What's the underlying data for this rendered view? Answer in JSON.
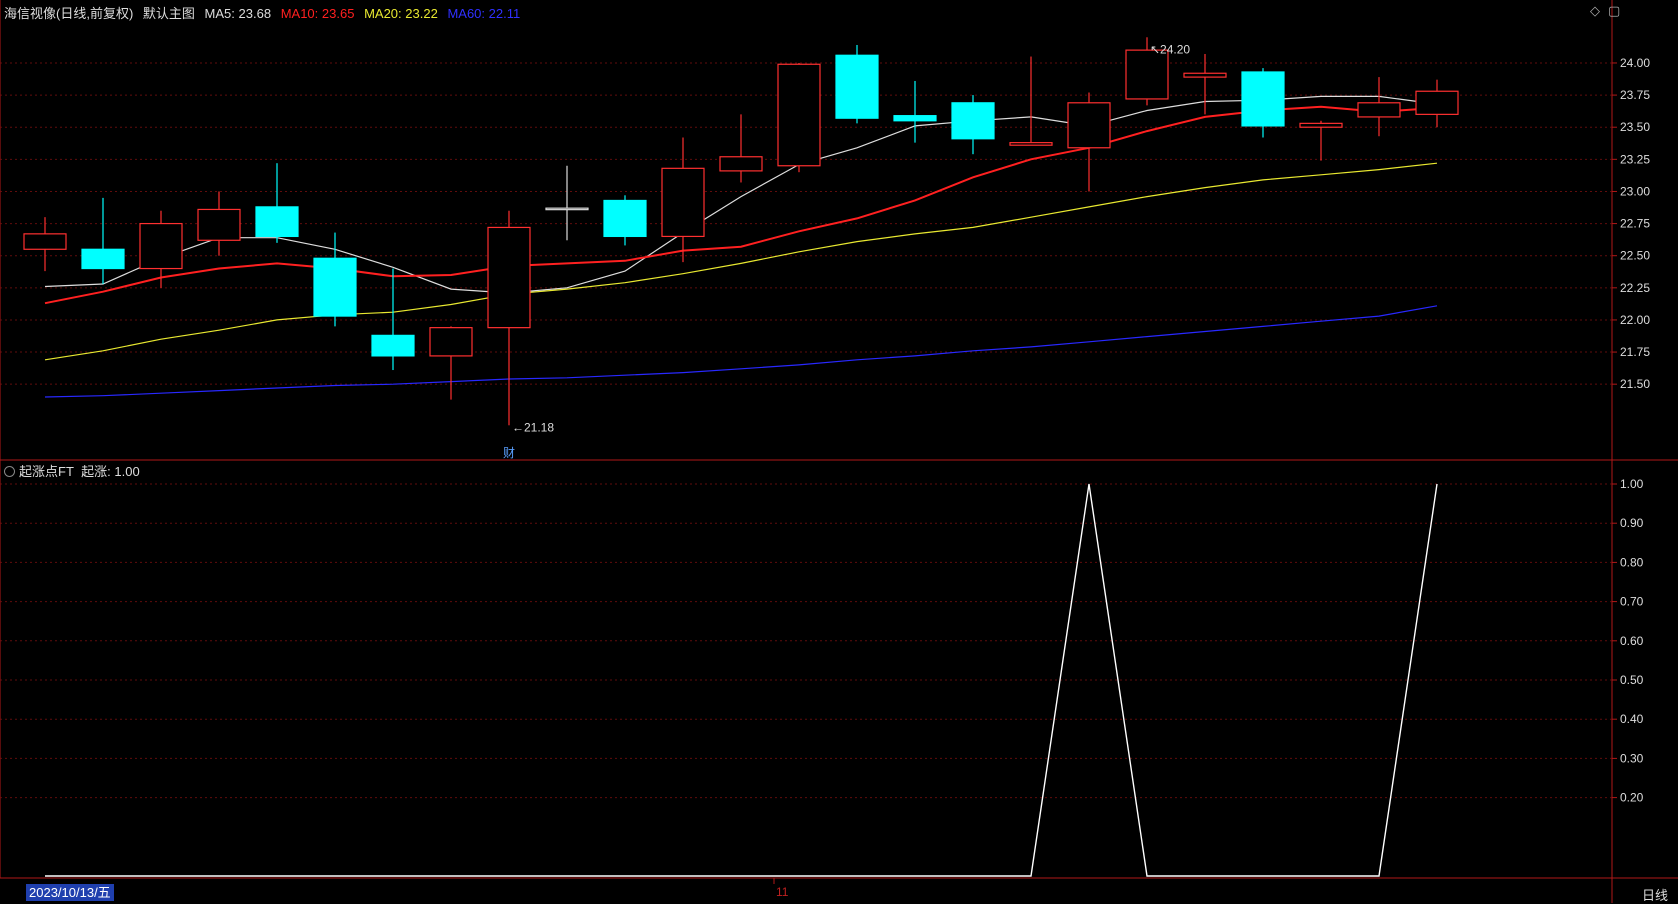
{
  "header": {
    "stock_name": "海信视像(日线,前复权)",
    "template": "默认主图",
    "ma5": {
      "label": "MA5:",
      "value": "23.68",
      "color": "#dddddd"
    },
    "ma10": {
      "label": "MA10:",
      "value": "23.65",
      "color": "#ff2020"
    },
    "ma20": {
      "label": "MA20:",
      "value": "23.22",
      "color": "#e8e830"
    },
    "ma60": {
      "label": "MA60:",
      "value": "22.11",
      "color": "#2828ff"
    }
  },
  "corner_icons": [
    "diamond-icon",
    "window-icon"
  ],
  "indicator_header": {
    "name": "起涨点FT",
    "series_label": "起涨:",
    "value": "1.00"
  },
  "footer": {
    "date": "2023/10/13/五",
    "month_tick": "11",
    "period": "日线"
  },
  "colors": {
    "up": "#ff3030",
    "down": "#00ffff",
    "axis": "#b01818",
    "grid": "#801010",
    "ma5": "#dddddd",
    "ma10": "#ff2020",
    "ma20": "#e8e830",
    "ma60": "#2828ff"
  },
  "chart_data": [
    {
      "type": "candlestick",
      "title": "海信视像(日线,前复权)",
      "y_ticks": [
        "24.00",
        "23.75",
        "23.50",
        "23.25",
        "23.00",
        "22.75",
        "22.50",
        "22.25",
        "22.00",
        "21.75",
        "21.50"
      ],
      "ylim": [
        21.05,
        24.35
      ],
      "candles": [
        {
          "o": 22.55,
          "h": 22.8,
          "l": 22.38,
          "c": 22.67
        },
        {
          "o": 22.55,
          "h": 22.95,
          "l": 22.28,
          "c": 22.4
        },
        {
          "o": 22.4,
          "h": 22.85,
          "l": 22.25,
          "c": 22.75
        },
        {
          "o": 22.62,
          "h": 23.0,
          "l": 22.5,
          "c": 22.86
        },
        {
          "o": 22.88,
          "h": 23.22,
          "l": 22.6,
          "c": 22.65
        },
        {
          "o": 22.48,
          "h": 22.68,
          "l": 21.95,
          "c": 22.03
        },
        {
          "o": 21.88,
          "h": 22.4,
          "l": 21.61,
          "c": 21.72
        },
        {
          "o": 21.72,
          "h": 21.95,
          "l": 21.38,
          "c": 21.94
        },
        {
          "o": 21.94,
          "h": 22.85,
          "l": 21.18,
          "c": 22.72
        },
        {
          "o": 22.87,
          "h": 23.2,
          "l": 22.62,
          "c": 22.87
        },
        {
          "o": 22.93,
          "h": 22.97,
          "l": 22.58,
          "c": 22.65
        },
        {
          "o": 22.65,
          "h": 23.42,
          "l": 22.45,
          "c": 23.18
        },
        {
          "o": 23.16,
          "h": 23.6,
          "l": 23.07,
          "c": 23.27
        },
        {
          "o": 23.2,
          "h": 24.0,
          "l": 23.15,
          "c": 23.99
        },
        {
          "o": 24.06,
          "h": 24.14,
          "l": 23.53,
          "c": 23.57
        },
        {
          "o": 23.59,
          "h": 23.86,
          "l": 23.38,
          "c": 23.55
        },
        {
          "o": 23.69,
          "h": 23.75,
          "l": 23.29,
          "c": 23.41
        },
        {
          "o": 23.36,
          "h": 24.05,
          "l": 23.36,
          "c": 23.38
        },
        {
          "o": 23.34,
          "h": 23.77,
          "l": 23.0,
          "c": 23.69
        },
        {
          "o": 23.72,
          "h": 24.2,
          "l": 23.67,
          "c": 24.1
        },
        {
          "o": 23.89,
          "h": 24.07,
          "l": 23.6,
          "c": 23.92
        },
        {
          "o": 23.93,
          "h": 23.96,
          "l": 23.42,
          "c": 23.51
        },
        {
          "o": 23.5,
          "h": 23.55,
          "l": 23.24,
          "c": 23.53
        },
        {
          "o": 23.58,
          "h": 23.89,
          "l": 23.43,
          "c": 23.69
        },
        {
          "o": 23.6,
          "h": 23.87,
          "l": 23.5,
          "c": 23.78
        }
      ],
      "series": [
        {
          "name": "MA5",
          "values": [
            22.26,
            22.28,
            22.48,
            22.64,
            22.64,
            22.55,
            22.41,
            22.24,
            22.21,
            22.25,
            22.38,
            22.68,
            22.96,
            23.21,
            23.34,
            23.51,
            23.55,
            23.58,
            23.51,
            23.63,
            23.7,
            23.71,
            23.74,
            23.74,
            23.68
          ]
        },
        {
          "name": "MA10",
          "values": [
            22.13,
            22.22,
            22.33,
            22.4,
            22.44,
            22.4,
            22.34,
            22.35,
            22.42,
            22.44,
            22.46,
            22.54,
            22.57,
            22.69,
            22.79,
            22.93,
            23.11,
            23.25,
            23.34,
            23.47,
            23.58,
            23.63,
            23.66,
            23.62,
            23.65
          ]
        },
        {
          "name": "MA20",
          "values": [
            21.69,
            21.76,
            21.85,
            21.92,
            22.0,
            22.04,
            22.06,
            22.12,
            22.2,
            22.24,
            22.29,
            22.36,
            22.44,
            22.53,
            22.61,
            22.67,
            22.72,
            22.8,
            22.88,
            22.96,
            23.03,
            23.09,
            23.13,
            23.17,
            23.22
          ]
        },
        {
          "name": "MA60",
          "values": [
            21.4,
            21.41,
            21.43,
            21.45,
            21.47,
            21.49,
            21.5,
            21.52,
            21.54,
            21.55,
            21.57,
            21.59,
            21.62,
            21.65,
            21.69,
            21.72,
            21.76,
            21.79,
            21.83,
            21.87,
            21.91,
            21.95,
            21.99,
            22.03,
            22.11
          ]
        }
      ],
      "annotations": [
        {
          "text": "24.20",
          "candle": 19,
          "price": 24.2
        },
        {
          "text": "21.18",
          "candle": 8,
          "price": 21.18
        },
        {
          "text": "财",
          "candle": 8
        }
      ]
    },
    {
      "type": "line",
      "title": "起涨点FT",
      "y_ticks": [
        "1.00",
        "0.90",
        "0.80",
        "0.70",
        "0.60",
        "0.50",
        "0.40",
        "0.30",
        "0.20"
      ],
      "ylim": [
        0,
        1.0
      ],
      "series": [
        {
          "name": "起涨",
          "values": [
            0,
            0,
            0,
            0,
            0,
            0,
            0,
            0,
            0,
            0,
            0,
            0,
            0,
            0,
            0,
            0,
            0,
            0,
            1,
            0,
            0,
            0,
            0,
            0,
            1
          ]
        }
      ]
    }
  ]
}
